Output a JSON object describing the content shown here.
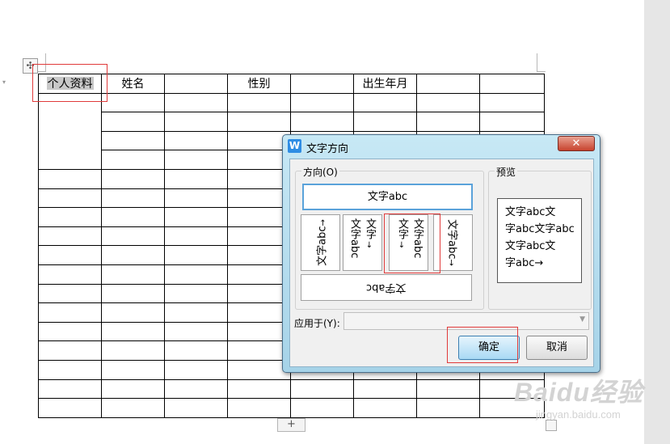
{
  "table": {
    "header": [
      "个人资料",
      "姓名",
      "",
      "性别",
      "",
      "出生年月",
      "",
      ""
    ],
    "total_rows": 18
  },
  "dialog": {
    "title": "文字方向",
    "close_glyph": "✕",
    "direction_group": "方向(O)",
    "preview_group": "预览",
    "option_horizontal": "文字abc",
    "option_horizontal_rotated": "文字abc",
    "vertical_chars": {
      "col1": "文字",
      "col2": "abc",
      "col3": "文字",
      "col4": "abc"
    },
    "down_arrow": "↓",
    "right_arrow": "→",
    "rotated_text": "文字abc",
    "preview_lines": [
      "文字abc文",
      "字abc文字abc",
      "文字abc文",
      "字abc→"
    ],
    "apply_label": "应用于(Y):",
    "apply_value": "",
    "ok_label": "确定",
    "cancel_label": "取消"
  },
  "handles": {
    "move": "✣",
    "add_row": "+"
  },
  "watermark": {
    "brand": "Baidu经验",
    "url": "jingyan.baidu.com"
  }
}
